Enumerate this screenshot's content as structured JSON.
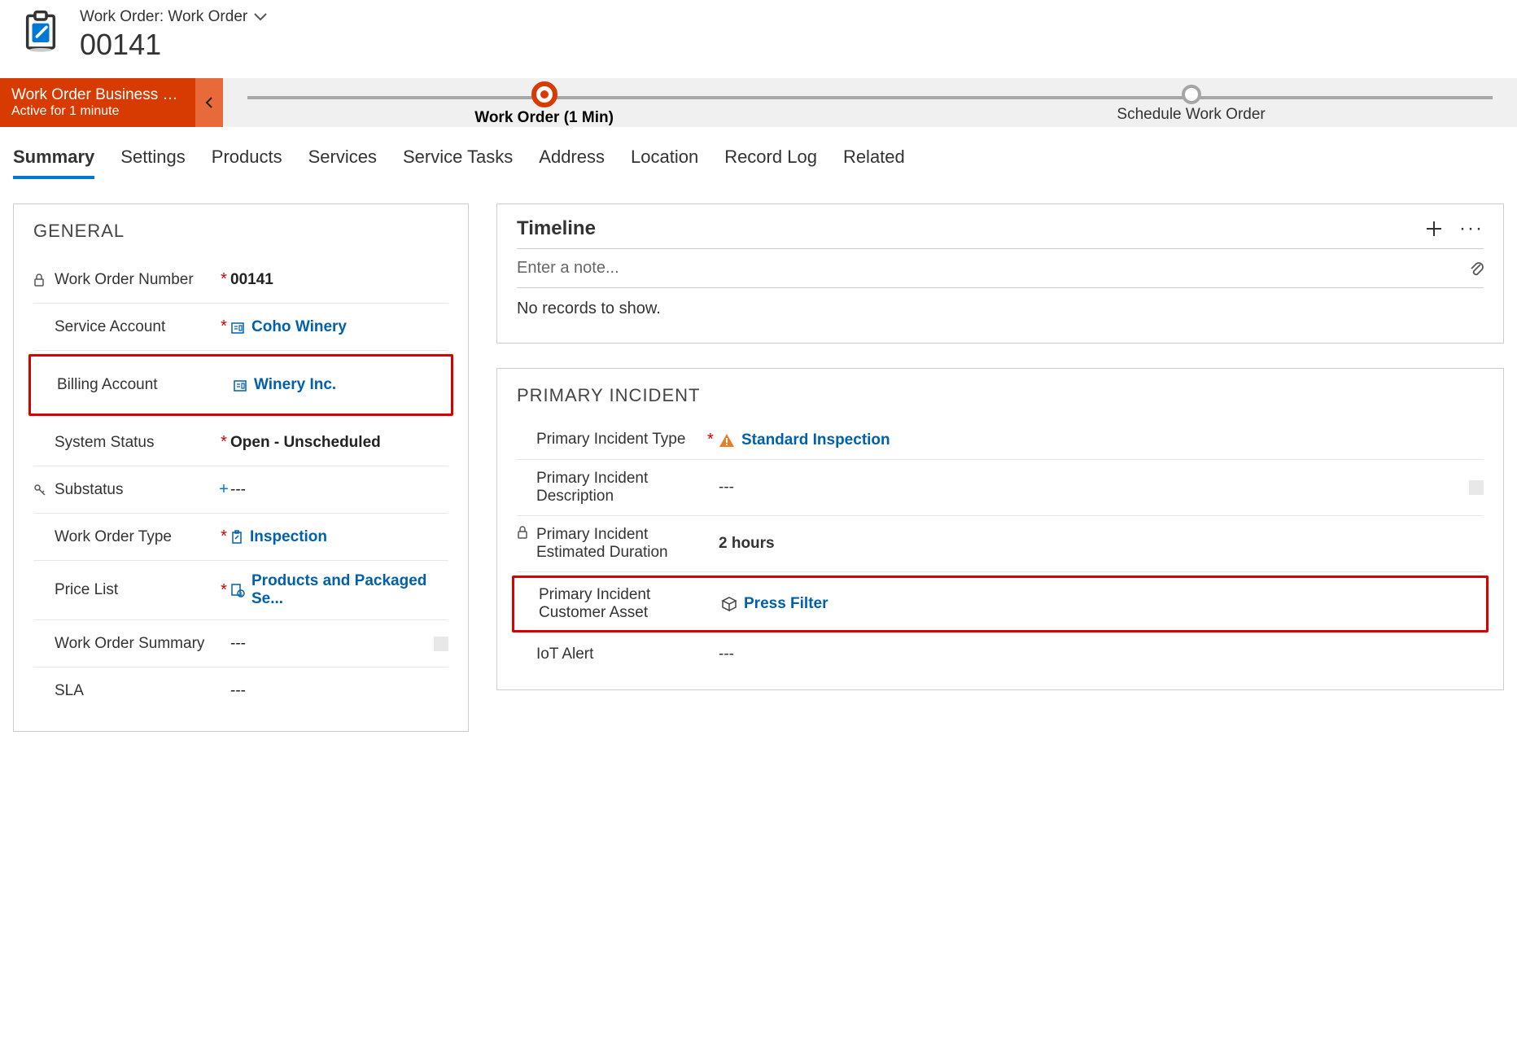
{
  "header": {
    "breadcrumb": "Work Order: Work Order",
    "title": "00141"
  },
  "bpf": {
    "name": "Work Order Business Pro...",
    "duration": "Active for 1 minute",
    "stages": [
      {
        "label": "Work Order  (1 Min)",
        "active": true
      },
      {
        "label": "Schedule Work Order",
        "active": false
      }
    ]
  },
  "tabs": [
    "Summary",
    "Settings",
    "Products",
    "Services",
    "Service Tasks",
    "Address",
    "Location",
    "Record Log",
    "Related"
  ],
  "active_tab": "Summary",
  "general": {
    "title": "GENERAL",
    "fields": {
      "work_order_number": {
        "label": "Work Order Number",
        "value": "00141",
        "locked": true,
        "required": true
      },
      "service_account": {
        "label": "Service Account",
        "value": "Coho Winery",
        "required": true,
        "link": true,
        "icon": "account-icon"
      },
      "billing_account": {
        "label": "Billing Account",
        "value": "Winery Inc.",
        "link": true,
        "icon": "account-icon",
        "highlight": true
      },
      "system_status": {
        "label": "System Status",
        "value": "Open - Unscheduled",
        "required": true
      },
      "substatus": {
        "label": "Substatus",
        "value": "---",
        "recommended": true,
        "key_icon": true
      },
      "work_order_type": {
        "label": "Work Order Type",
        "value": "Inspection",
        "required": true,
        "link": true,
        "icon": "clipboard-icon"
      },
      "price_list": {
        "label": "Price List",
        "value": "Products and Packaged Se...",
        "required": true,
        "link": true,
        "icon": "pricelist-icon"
      },
      "work_order_summary": {
        "label": "Work Order Summary",
        "value": "---"
      },
      "sla": {
        "label": "SLA",
        "value": "---"
      }
    }
  },
  "timeline": {
    "title": "Timeline",
    "note_placeholder": "Enter a note...",
    "empty": "No records to show."
  },
  "primary_incident": {
    "title": "PRIMARY INCIDENT",
    "fields": {
      "type": {
        "label": "Primary Incident Type",
        "value": "Standard Inspection",
        "required": true,
        "link": true,
        "warn": true
      },
      "description": {
        "label": "Primary Incident Description",
        "value": "---"
      },
      "duration": {
        "label": "Primary Incident Estimated Duration",
        "value": "2 hours",
        "locked": true
      },
      "asset": {
        "label": "Primary Incident Customer Asset",
        "value": "Press Filter",
        "link": true,
        "asset_icon": true,
        "highlight": true
      },
      "iot": {
        "label": "IoT Alert",
        "value": "---"
      }
    }
  }
}
